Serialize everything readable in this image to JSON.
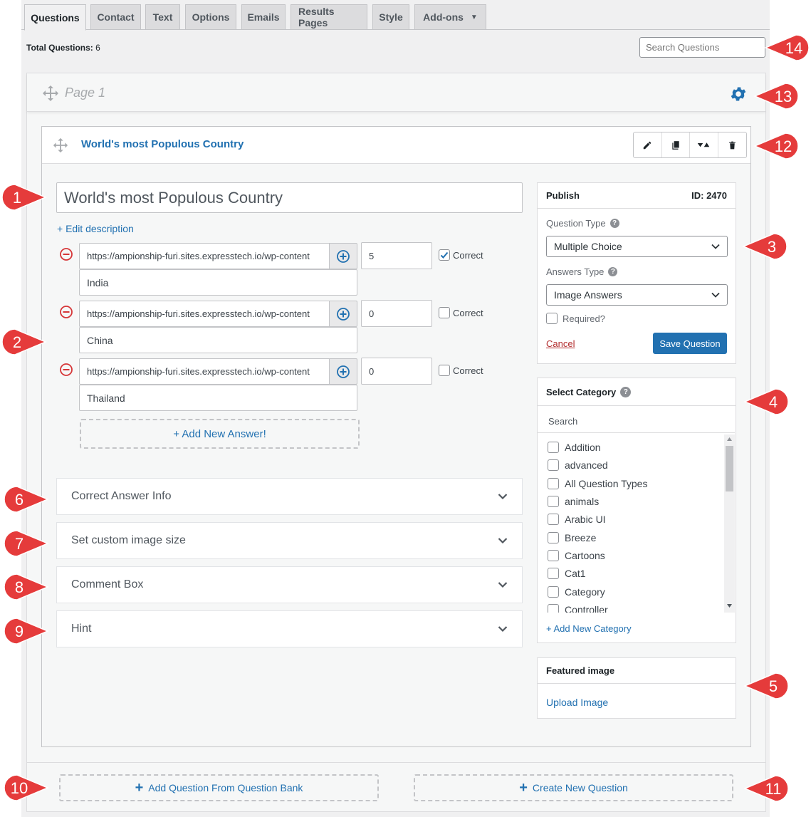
{
  "tabs": [
    {
      "label": "Questions",
      "active": true
    },
    {
      "label": "Contact"
    },
    {
      "label": "Text"
    },
    {
      "label": "Options"
    },
    {
      "label": "Emails"
    },
    {
      "label": "Results Pages"
    },
    {
      "label": "Style"
    },
    {
      "label": "Add-ons",
      "dropdown": true
    }
  ],
  "toolbar": {
    "total_label": "Total Questions:",
    "total_count": "6",
    "search_placeholder": "Search Questions"
  },
  "page": {
    "title": "Page 1"
  },
  "question": {
    "header_title": "World's most Populous Country",
    "title": "World's most Populous Country",
    "edit_description": "+ Edit description",
    "answers": [
      {
        "url": "https://ampionship-furi.sites.expresstech.io/wp-content",
        "points": "5",
        "correct_label": "Correct",
        "correct": true,
        "text": "India"
      },
      {
        "url": "https://ampionship-furi.sites.expresstech.io/wp-content",
        "points": "0",
        "correct_label": "Correct",
        "correct": false,
        "text": "China"
      },
      {
        "url": "https://ampionship-furi.sites.expresstech.io/wp-content",
        "points": "0",
        "correct_label": "Correct",
        "correct": false,
        "text": "Thailand"
      }
    ],
    "add_answer": "+ Add New Answer!",
    "sections": [
      "Correct Answer Info",
      "Set custom image size",
      "Comment Box",
      "Hint"
    ]
  },
  "publish": {
    "title": "Publish",
    "id_label": "ID: 2470",
    "question_type_label": "Question Type",
    "question_type_value": "Multiple Choice",
    "answers_type_label": "Answers Type",
    "answers_type_value": "Image Answers",
    "required_label": "Required?",
    "cancel_label": "Cancel",
    "save_label": "Save Question"
  },
  "category": {
    "title": "Select Category",
    "search_placeholder": "Search",
    "items": [
      "Addition",
      "advanced",
      "All Question Types",
      "animals",
      "Arabic UI",
      "Breeze",
      "Cartoons",
      "Cat1",
      "Category",
      "Controller"
    ],
    "add_label": "+ Add New Category"
  },
  "featured_image": {
    "title": "Featured image",
    "upload_label": "Upload Image"
  },
  "footer": {
    "bank_label": "Add Question From Question Bank",
    "create_label": "Create New Question"
  },
  "callouts": [
    "1",
    "2",
    "3",
    "4",
    "5",
    "6",
    "7",
    "8",
    "9",
    "10",
    "11",
    "12",
    "13",
    "14"
  ],
  "colors": {
    "accent": "#2271b1",
    "danger": "#d63638",
    "callout": "#e53b3b"
  }
}
